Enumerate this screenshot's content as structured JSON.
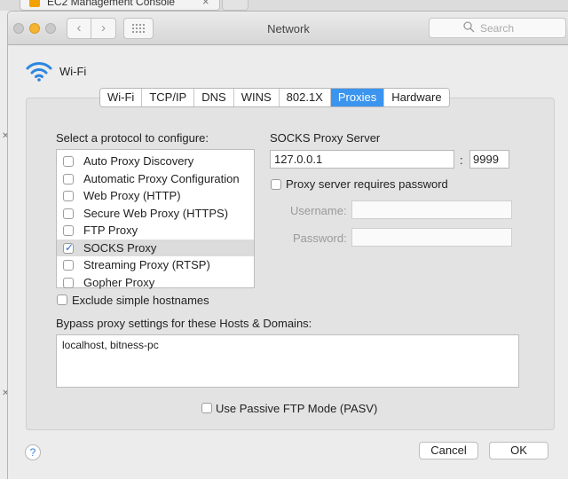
{
  "browser": {
    "tab_title": "EC2 Management Console",
    "tab_close": "×"
  },
  "window": {
    "title": "Network",
    "search_placeholder": "Search",
    "nav_back": "‹",
    "nav_forward": "›"
  },
  "interface": {
    "name": "Wi-Fi",
    "icon": "wifi-icon"
  },
  "tabs": [
    {
      "label": "Wi-Fi",
      "active": false
    },
    {
      "label": "TCP/IP",
      "active": false
    },
    {
      "label": "DNS",
      "active": false
    },
    {
      "label": "WINS",
      "active": false
    },
    {
      "label": "802.1X",
      "active": false
    },
    {
      "label": "Proxies",
      "active": true
    },
    {
      "label": "Hardware",
      "active": false
    }
  ],
  "protocols": {
    "label": "Select a protocol to configure:",
    "items": [
      {
        "label": "Auto Proxy Discovery",
        "checked": false
      },
      {
        "label": "Automatic Proxy Configuration",
        "checked": false
      },
      {
        "label": "Web Proxy (HTTP)",
        "checked": false
      },
      {
        "label": "Secure Web Proxy (HTTPS)",
        "checked": false
      },
      {
        "label": "FTP Proxy",
        "checked": false
      },
      {
        "label": "SOCKS Proxy",
        "checked": true,
        "selected": true
      },
      {
        "label": "Streaming Proxy (RTSP)",
        "checked": false
      },
      {
        "label": "Gopher Proxy",
        "checked": false
      }
    ]
  },
  "socks": {
    "title": "SOCKS Proxy Server",
    "server": "127.0.0.1",
    "separator": ":",
    "port": "9999",
    "requires_password_label": "Proxy server requires password",
    "requires_password": false,
    "username_label": "Username:",
    "username": "",
    "password_label": "Password:",
    "password": ""
  },
  "exclude_simple": {
    "label": "Exclude simple hostnames",
    "checked": false
  },
  "bypass": {
    "label": "Bypass proxy settings for these Hosts & Domains:",
    "value": "localhost, bitness-pc"
  },
  "pasv": {
    "label": "Use Passive FTP Mode (PASV)",
    "checked": false
  },
  "buttons": {
    "help": "?",
    "cancel": "Cancel",
    "ok": "OK"
  },
  "colors": {
    "accent": "#3b95ef",
    "checkmark": "#2a6cd6",
    "minimize": "#f5b332"
  }
}
